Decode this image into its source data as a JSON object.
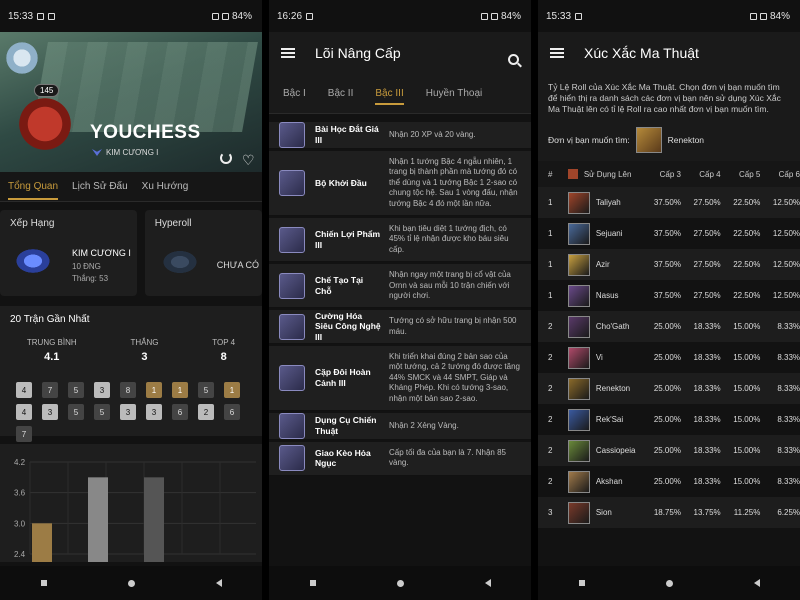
{
  "phone1": {
    "status": {
      "time": "15:33",
      "battery": "84%"
    },
    "profile": {
      "level": "145",
      "name": "YOUCHESS",
      "rank": "KIM CƯƠNG I"
    },
    "tabs": [
      "Tổng Quan",
      "Lịch Sử Đấu",
      "Xu Hướng"
    ],
    "rank_card": {
      "title": "Xếp Hạng",
      "tier": "KIM CƯƠNG I",
      "lp": "10 ĐNG",
      "wins": "Thắng: 53"
    },
    "hyperroll_card": {
      "title": "Hyperoll",
      "tier": "CHƯA CÓ"
    },
    "recent": {
      "title": "20 Trận Gần Nhất",
      "stats": [
        {
          "label": "TRUNG BÌNH",
          "value": "4.1"
        },
        {
          "label": "THẮNG",
          "value": "3"
        },
        {
          "label": "TOP 4",
          "value": "8"
        }
      ],
      "placements": [
        {
          "v": "4",
          "s": "light"
        },
        {
          "v": "7",
          "s": "dark"
        },
        {
          "v": "5",
          "s": "dark"
        },
        {
          "v": "3",
          "s": "light"
        },
        {
          "v": "8",
          "s": "dark"
        },
        {
          "v": "1",
          "s": "gold"
        },
        {
          "v": "1",
          "s": "gold"
        },
        {
          "v": "5",
          "s": "dark"
        },
        {
          "v": "1",
          "s": "gold"
        },
        {
          "v": "4",
          "s": "light"
        },
        {
          "v": "3",
          "s": "light"
        },
        {
          "v": "5",
          "s": "dark"
        },
        {
          "v": "5",
          "s": "dark"
        },
        {
          "v": "3",
          "s": "light"
        },
        {
          "v": "3",
          "s": "light"
        },
        {
          "v": "6",
          "s": "dark"
        },
        {
          "v": "2",
          "s": "light"
        },
        {
          "v": "6",
          "s": "dark"
        },
        {
          "v": "7",
          "s": "dark"
        }
      ]
    },
    "chart_data": {
      "type": "bar",
      "yticks": [
        "4.2",
        "3.6",
        "3.0",
        "2.4"
      ],
      "ylim": [
        2.4,
        4.2
      ],
      "values": [
        3.0,
        3.9,
        3.9
      ],
      "colors": [
        "#9c7c45",
        "#888888",
        "#555555"
      ]
    }
  },
  "phone2": {
    "status": {
      "time": "16:26",
      "battery": "84%"
    },
    "title": "Lõi Nâng Cấp",
    "tabs": [
      "Bậc I",
      "Bậc II",
      "Bậc III",
      "Huyền Thoại"
    ],
    "augments": [
      {
        "name": "Bài Học Đắt Giá III",
        "desc": "Nhận 20 XP và 20 vàng.",
        "icon": "book-icon"
      },
      {
        "name": "Bộ Khởi Đầu",
        "desc": "Nhận 1 tướng Bậc 4 ngẫu nhiên, 1 trang bị thành phần mà tướng đó có thể dùng và 1 tướng Bậc 1 2-sao có chung tộc hệ. Sau 1 vòng đấu, nhận tướng Bậc 4 đó một lần nữa.",
        "icon": "starter-icon"
      },
      {
        "name": "Chiến Lợi Phẩm III",
        "desc": "Khi bạn tiêu diệt 1 tướng địch, có 45% tỉ lệ nhận được kho báu siêu cấp.",
        "icon": "loot-icon"
      },
      {
        "name": "Chế Tạo Tại Chỗ",
        "desc": "Nhận ngay một trang bị cổ vật của Ornn và sau mỗi 10 trận chiến với người chơi.",
        "icon": "anvil-icon"
      },
      {
        "name": "Cường Hóa Siêu Công Nghệ III",
        "desc": "Tướng có sở hữu trang bị nhận 500 máu.",
        "icon": "heart-tech-icon"
      },
      {
        "name": "Cặp Đôi Hoàn Cảnh III",
        "desc": "Khi triển khai đúng 2 bản sao của một tướng, cả 2 tướng đó được tăng 44% SMCK và 44 SMPT, Giáp và Kháng Phép. Khi có tướng 3-sao, nhận một bản sao 2-sao.",
        "icon": "pair-icon"
      },
      {
        "name": "Dụng Cụ Chiến Thuật",
        "desc": "Nhận 2 Xẻng Vàng.",
        "icon": "spatula-icon"
      },
      {
        "name": "Giao Kèo Hỏa Ngục",
        "desc": "Cấp tối đa của bạn là 7. Nhận 85 vàng.",
        "icon": "pact-icon"
      }
    ]
  },
  "phone3": {
    "status": {
      "time": "15:33",
      "battery": "84%"
    },
    "title": "Xúc Xắc Ma Thuật",
    "intro": "Tỷ Lệ Roll của Xúc Xắc Ma Thuật. Chọn đơn vị bạn muốn tìm để hiển thị ra danh sách các đơn vị bạn nên sử dụng Xúc Xắc Ma Thuật lên có tỉ lệ Roll ra cao nhất đơn vị bạn muốn tìm.",
    "pick_label": "Đơn vị bạn muốn tìm:",
    "pick_value": "Renekton",
    "headers": [
      "#",
      "Sử Dụng Lên",
      "Cấp 3",
      "Cấp 4",
      "Cấp 5",
      "Cấp 6"
    ],
    "rows": [
      {
        "idx": "1",
        "name": "Taliyah",
        "c3": "37.50%",
        "c4": "27.50%",
        "c5": "22.50%",
        "c6": "12.50%",
        "color": "#a0452a"
      },
      {
        "idx": "1",
        "name": "Sejuani",
        "c3": "37.50%",
        "c4": "27.50%",
        "c5": "22.50%",
        "c6": "12.50%",
        "color": "#4a6a9a"
      },
      {
        "idx": "1",
        "name": "Azir",
        "c3": "37.50%",
        "c4": "27.50%",
        "c5": "22.50%",
        "c6": "12.50%",
        "color": "#c8a040"
      },
      {
        "idx": "1",
        "name": "Nasus",
        "c3": "37.50%",
        "c4": "27.50%",
        "c5": "22.50%",
        "c6": "12.50%",
        "color": "#6a4a8a"
      },
      {
        "idx": "2",
        "name": "Cho'Gath",
        "c3": "25.00%",
        "c4": "18.33%",
        "c5": "15.00%",
        "c6": "8.33%",
        "color": "#5a3a6a"
      },
      {
        "idx": "2",
        "name": "Vi",
        "c3": "25.00%",
        "c4": "18.33%",
        "c5": "15.00%",
        "c6": "8.33%",
        "color": "#b04a6a"
      },
      {
        "idx": "2",
        "name": "Renekton",
        "c3": "25.00%",
        "c4": "18.33%",
        "c5": "15.00%",
        "c6": "8.33%",
        "color": "#8a6a2a"
      },
      {
        "idx": "2",
        "name": "Rek'Sai",
        "c3": "25.00%",
        "c4": "18.33%",
        "c5": "15.00%",
        "c6": "8.33%",
        "color": "#3a5aa0"
      },
      {
        "idx": "2",
        "name": "Cassiopeia",
        "c3": "25.00%",
        "c4": "18.33%",
        "c5": "15.00%",
        "c6": "8.33%",
        "color": "#6a8a3a"
      },
      {
        "idx": "2",
        "name": "Akshan",
        "c3": "25.00%",
        "c4": "18.33%",
        "c5": "15.00%",
        "c6": "8.33%",
        "color": "#a07a4a"
      },
      {
        "idx": "3",
        "name": "Sion",
        "c3": "18.75%",
        "c4": "13.75%",
        "c5": "11.25%",
        "c6": "6.25%",
        "color": "#7a3a2a"
      }
    ]
  }
}
